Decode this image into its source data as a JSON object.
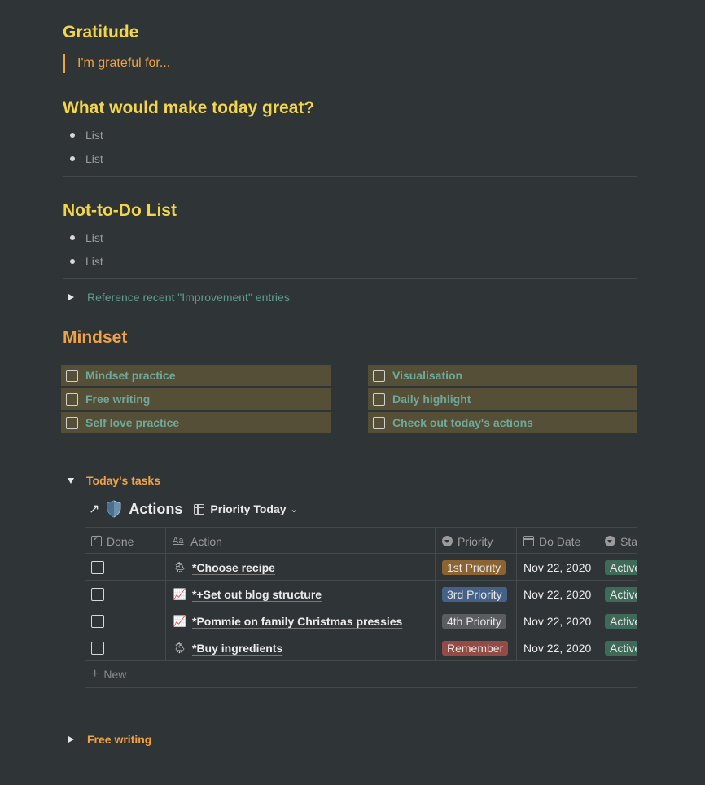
{
  "gratitude": {
    "heading": "Gratitude",
    "quote": "I'm grateful for..."
  },
  "great_today": {
    "heading": "What would make today great?",
    "items": [
      "List",
      "List"
    ]
  },
  "not_to_do": {
    "heading": "Not-to-Do List",
    "items": [
      "List",
      "List"
    ]
  },
  "reference_toggle": "Reference recent \"Improvement\" entries",
  "mindset": {
    "heading": "Mindset",
    "left": [
      "Mindset practice",
      "Free writing",
      "Self love practice"
    ],
    "right": [
      "Visualisation",
      "Daily highlight",
      "Check out today's actions"
    ]
  },
  "todays_tasks": {
    "toggle": "Today's tasks",
    "db_title": "Actions",
    "db_icon": "shield-icon",
    "view": "Priority Today",
    "columns": {
      "done": "Done",
      "action": "Action",
      "priority": "Priority",
      "date": "Do Date",
      "status": "Sta"
    },
    "rows": [
      {
        "icon": "🌦",
        "action": "*Choose recipe",
        "priority": "1st Priority",
        "priority_color": "#8c6433",
        "date": "Nov 22, 2020",
        "status": "Active"
      },
      {
        "icon": "📈",
        "action": "*+Set out blog structure",
        "priority": "3rd Priority",
        "priority_color": "#466187",
        "date": "Nov 22, 2020",
        "status": "Active"
      },
      {
        "icon": "📈",
        "action": "*Pommie on family Christmas pressies",
        "priority": "4th Priority",
        "priority_color": "#5a5d60",
        "date": "Nov 22, 2020",
        "status": "Active"
      },
      {
        "icon": "🌦",
        "action": "*Buy ingredients",
        "priority": "Remember",
        "priority_color": "#944b46",
        "date": "Nov 22, 2020",
        "status": "Active"
      }
    ],
    "new_label": "New"
  },
  "free_writing_toggle": "Free writing",
  "colors": {
    "background": "#2f3437",
    "heading_yellow": "#f2d54a",
    "heading_orange": "#f0a245",
    "teal": "#5e9e8e",
    "habit_bg": "#544f36",
    "status_green": "#3f6a5a"
  }
}
